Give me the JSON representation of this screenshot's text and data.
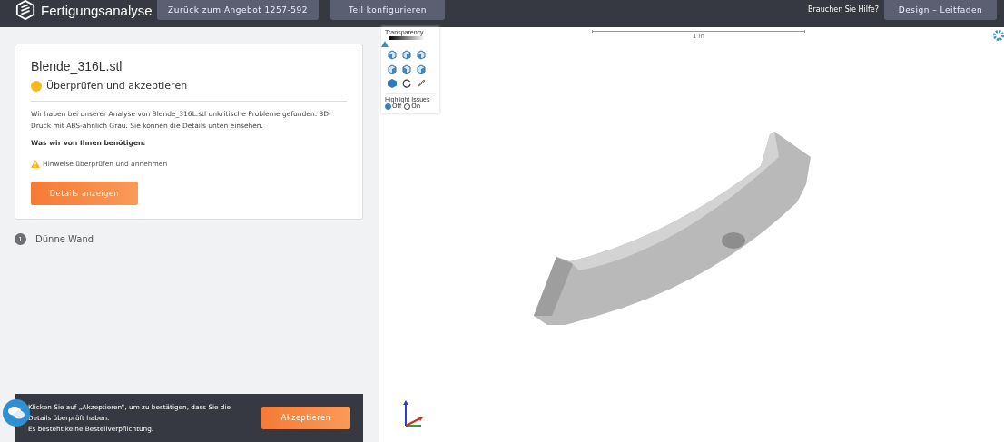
{
  "header": {
    "title": "Fertigungsanalyse",
    "nav_buttons": [
      "Zurück zum Angebot 1257-592",
      "Teil konfigurieren"
    ],
    "help_text": "Brauchen Sie Hilfe?",
    "guide_button": "Design – Leitfaden"
  },
  "card": {
    "file_name": "Blende_316L.stl",
    "status": "Überprüfen und akzeptieren",
    "description": "Wir haben bei unserer Analyse von Blende_316L.stl unkritische Probleme gefunden: 3D-Druck mit ABS-ähnlich Grau. Sie können die Details unten einsehen.",
    "needs_heading": "Was wir von Ihnen benötigen:",
    "warning": "Hinweise überprüfen und annehmen",
    "details_button": "Details anzeigen"
  },
  "issues": [
    {
      "number": "1",
      "label": "Dünne Wand"
    }
  ],
  "banner": {
    "lines": [
      "Klicken Sie auf „Akzeptieren“, um zu bestätigen, dass Sie die Details überprüft haben.",
      "Es besteht keine Bestellverpflichtung."
    ],
    "accept_button": "Akzeptieren"
  },
  "viewer": {
    "transparency": {
      "label": "Transparency",
      "level": 0
    },
    "highlight": {
      "label": "Highlight Issues",
      "options": [
        {
          "label": "Off",
          "selected": true
        },
        {
          "label": "On",
          "selected": false
        }
      ]
    },
    "scale_label": "1 in"
  }
}
